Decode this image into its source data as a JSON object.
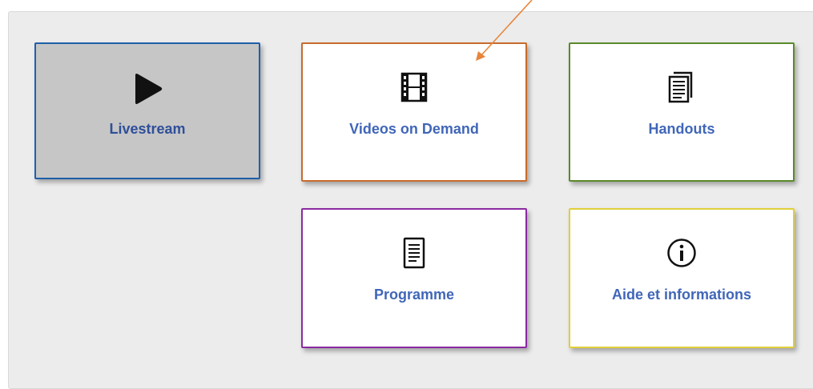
{
  "tiles": {
    "livestream": {
      "label": "Livestream",
      "icon": "play-icon",
      "border_color": "#1f5fa8",
      "background": "#c6c6c6"
    },
    "vod": {
      "label": "Videos on Demand",
      "icon": "film-icon",
      "border_color": "#c86b2c"
    },
    "handouts": {
      "label": "Handouts",
      "icon": "document-stack-icon",
      "border_color": "#5a8a2a"
    },
    "programme": {
      "label": "Programme",
      "icon": "list-document-icon",
      "border_color": "#8a2aa0"
    },
    "aide": {
      "label": "Aide et informations",
      "icon": "info-icon",
      "border_color": "#e0cf3a"
    }
  },
  "colors": {
    "panel_background": "#ececec",
    "label_text": "#4066b8",
    "annotation_arrow": "#e8853a"
  }
}
